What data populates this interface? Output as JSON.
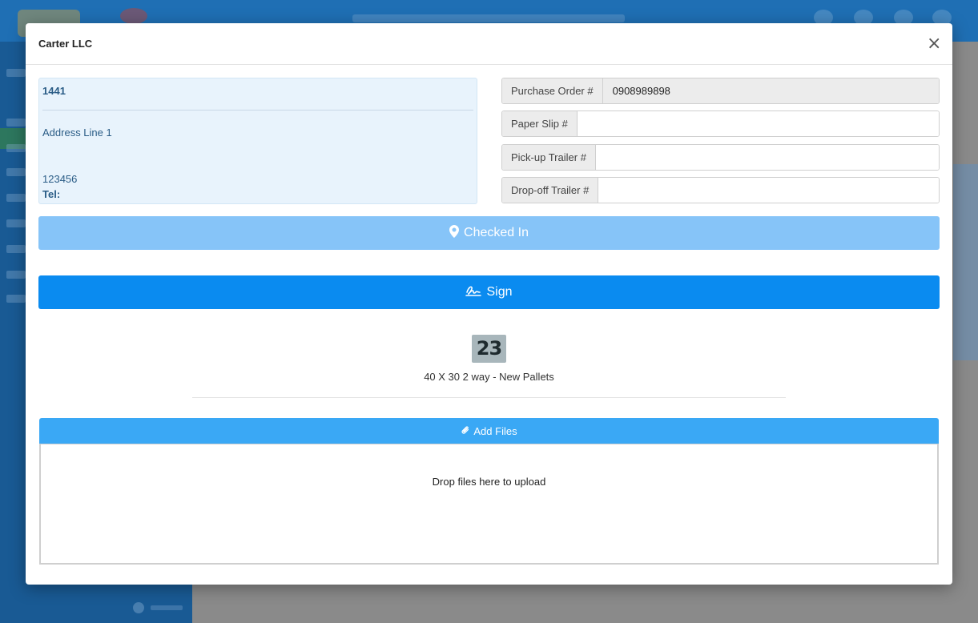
{
  "modal": {
    "title": "Carter LLC",
    "close_symbol": "×"
  },
  "address": {
    "id": "1441",
    "line1": "Address Line 1",
    "postal": "123456",
    "tel_label": "Tel:"
  },
  "fields": [
    {
      "label": "Purchase Order #",
      "value": "0908989898",
      "readonly": true
    },
    {
      "label": "Paper Slip #",
      "value": ""
    },
    {
      "label": "Pick-up Trailer #",
      "value": ""
    },
    {
      "label": "Drop-off Trailer #",
      "value": ""
    }
  ],
  "actions": {
    "checked_in_label": "Checked In",
    "sign_label": "Sign",
    "add_files_label": "Add Files"
  },
  "pallet": {
    "quantity": "23",
    "description": "40 X 30 2 way - New Pallets"
  },
  "dropzone": {
    "text": "Drop files here to upload"
  },
  "colors": {
    "checked_in_bg": "#86c4f8",
    "sign_bg": "#0a8bf0",
    "add_files_bg": "#3aa8f5",
    "address_bg": "#e8f3fc",
    "badge_bg": "#a8b6bb"
  },
  "icons": {
    "checked_in": "map-marker-icon",
    "sign": "signature-icon",
    "add_files": "paperclip-icon",
    "close": "close-icon"
  }
}
